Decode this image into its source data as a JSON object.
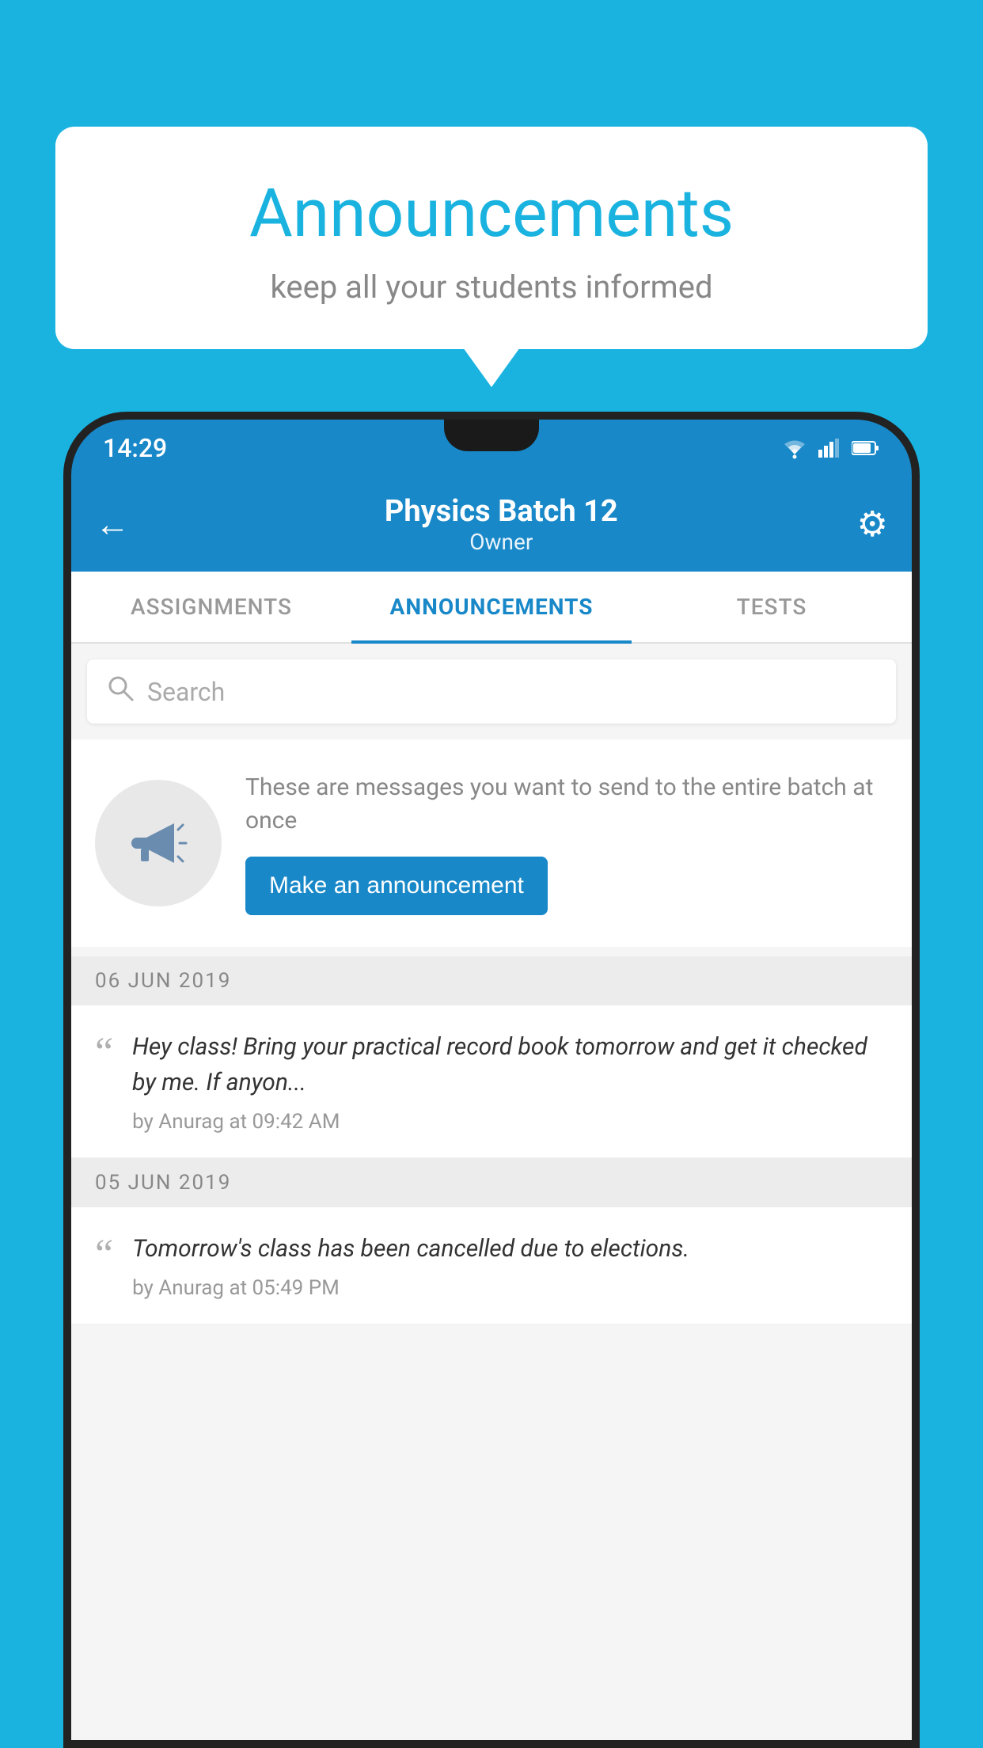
{
  "background_color": "#1ab3e0",
  "speech_bubble": {
    "title": "Announcements",
    "subtitle": "keep all your students informed"
  },
  "status_bar": {
    "time": "14:29"
  },
  "app_bar": {
    "title": "Physics Batch 12",
    "subtitle": "Owner"
  },
  "tabs": [
    {
      "label": "ASSIGNMENTS",
      "active": false
    },
    {
      "label": "ANNOUNCEMENTS",
      "active": true
    },
    {
      "label": "TESTS",
      "active": false
    }
  ],
  "search": {
    "placeholder": "Search"
  },
  "promo": {
    "description": "These are messages you want to send to the entire batch at once",
    "button_label": "Make an announcement"
  },
  "announcements": [
    {
      "date": "06  JUN  2019",
      "message": "Hey class! Bring your practical record book tomorrow and get it checked by me. If anyon...",
      "meta": "by Anurag at 09:42 AM"
    },
    {
      "date": "05  JUN  2019",
      "message": "Tomorrow's class has been cancelled due to elections.",
      "meta": "by Anurag at 05:49 PM"
    }
  ]
}
